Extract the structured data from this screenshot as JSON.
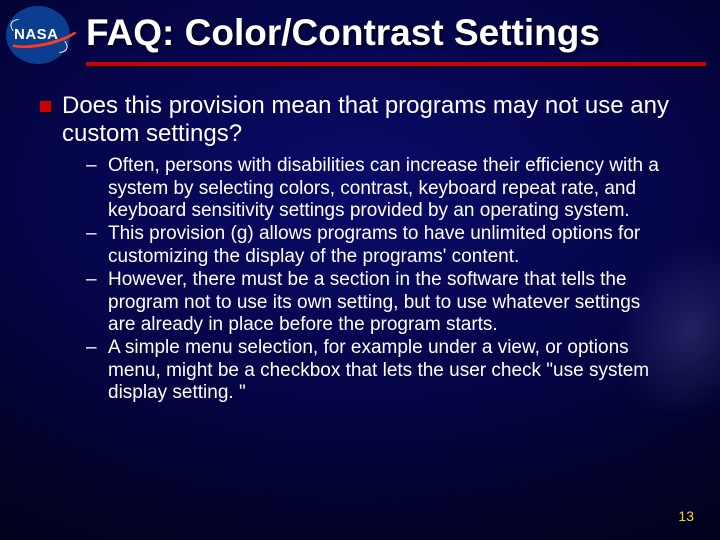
{
  "logo": {
    "text": "NASA"
  },
  "title": "FAQ: Color/Contrast Settings",
  "main_question": "Does this provision mean that programs may not use any custom settings?",
  "sub_items": [
    "Often, persons with disabilities can increase their efficiency with a system by selecting colors, contrast, keyboard repeat rate, and keyboard sensitivity settings provided by an operating system.",
    "This provision (g) allows programs to have unlimited options for customizing the display of the programs' content.",
    "However, there must be a section in the software that tells the program not to use its own setting, but to use whatever settings are already in place before the program starts.",
    "A simple menu selection, for example under a view, or options menu, might be a checkbox that lets the user check \"use system display setting. \""
  ],
  "page_number": "13"
}
